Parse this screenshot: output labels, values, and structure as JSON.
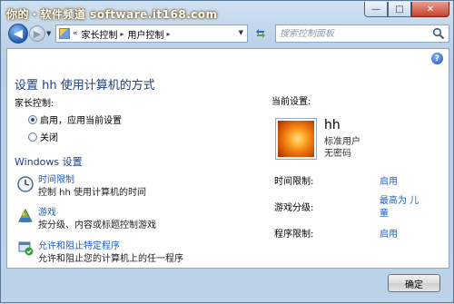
{
  "watermark": "你的・软件频道 software.it168.com",
  "window_buttons": {
    "minimize": "—",
    "maximize": "□",
    "close": "✕"
  },
  "breadcrumb": {
    "prefix": "«",
    "items": [
      "家长控制",
      "用户控制"
    ],
    "separator": "▸"
  },
  "search": {
    "placeholder": "搜索控制面板"
  },
  "help_label": "?",
  "main": {
    "heading": "设置 hh 使用计算机的方式",
    "parental_label": "家长控制:",
    "options": [
      {
        "label": "启用，应用当前设置",
        "selected": true
      },
      {
        "label": "关闭",
        "selected": false
      }
    ],
    "windows_settings_label": "Windows 设置",
    "settings": [
      {
        "link": "时间限制",
        "description": "控制 hh 使用计算机的时间",
        "icon": "clock-icon"
      },
      {
        "link": "游戏",
        "description": "按分级、内容或标题控制游戏",
        "icon": "games-icon"
      },
      {
        "link": "允许和阻止特定程序",
        "description": "允许和阻止您的计算机上的任一程序",
        "icon": "programs-icon"
      }
    ]
  },
  "current": {
    "title": "当前设置:",
    "user_name": "hh",
    "user_type": "标准用户",
    "password": "无密码",
    "rows": [
      {
        "key": "时间限制:",
        "value": "启用"
      },
      {
        "key": "游戏分级:",
        "value": "最高为 儿",
        "value2": "童"
      },
      {
        "key": "程序限制:",
        "value": "启用"
      }
    ]
  },
  "ok_button": "确定",
  "colors": {
    "link": "#1f5fbf",
    "heading": "#1e3f7e",
    "frame": "#bcd2e8"
  }
}
